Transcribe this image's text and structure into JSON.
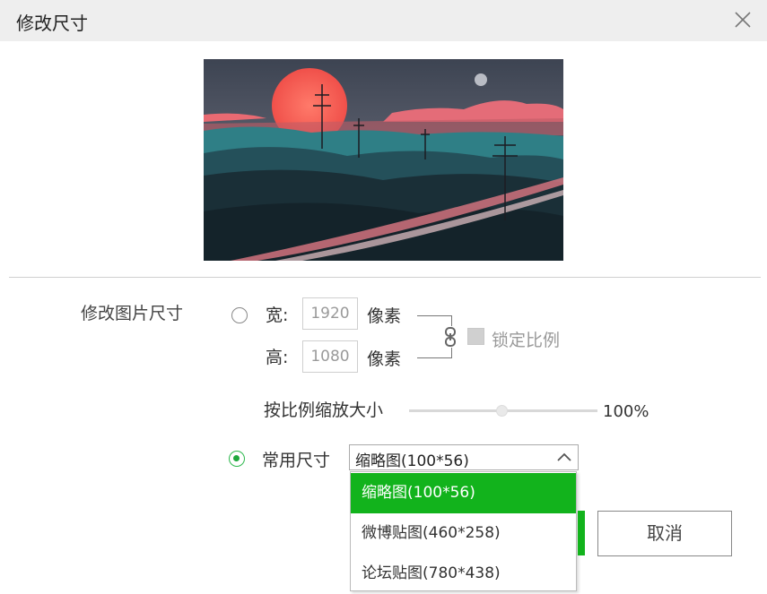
{
  "dialog": {
    "title": "修改尺寸",
    "close_icon": "close-icon"
  },
  "preview": {
    "alt": "preview-image"
  },
  "resize": {
    "section_label": "修改图片尺寸",
    "custom": {
      "width_label": "宽:",
      "width_value": "1920",
      "height_label": "高:",
      "height_value": "1080",
      "unit": "像素",
      "link_icon": "chain-link-icon",
      "lock_ratio_label": "锁定比例",
      "lock_ratio_checked": false
    },
    "scale": {
      "label": "按比例缩放大小",
      "value_text": "100%",
      "fraction": 0.5
    },
    "preset": {
      "label": "常用尺寸",
      "selected": "缩略图(100*56)",
      "options": [
        "缩略图(100*56)",
        "微博贴图(460*258)",
        "论坛贴图(780*438)"
      ]
    }
  },
  "buttons": {
    "cancel": "取消"
  },
  "colors": {
    "accent": "#12b31c",
    "titlebar": "#eeeeee"
  }
}
